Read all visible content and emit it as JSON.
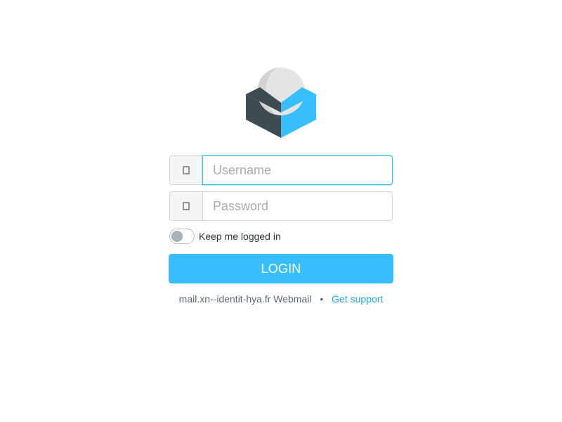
{
  "logo": {
    "icon": "roundcube-logo-icon",
    "colors": {
      "box_dark": "#3d4b52",
      "box_light": "#37beff",
      "sphere": "#e3e3e3"
    }
  },
  "form": {
    "username": {
      "icon": "user-icon",
      "value": "",
      "placeholder": "Username"
    },
    "password": {
      "icon": "lock-icon",
      "value": "",
      "placeholder": "Password"
    },
    "remember": {
      "label": "Keep me logged in",
      "checked": false
    },
    "login_button": "LOGIN"
  },
  "footer": {
    "product": "mail.xn--identit-hya.fr Webmail",
    "separator": "•",
    "support_link": "Get support"
  },
  "colors": {
    "accent": "#37beff",
    "link": "#1fa8ea"
  }
}
